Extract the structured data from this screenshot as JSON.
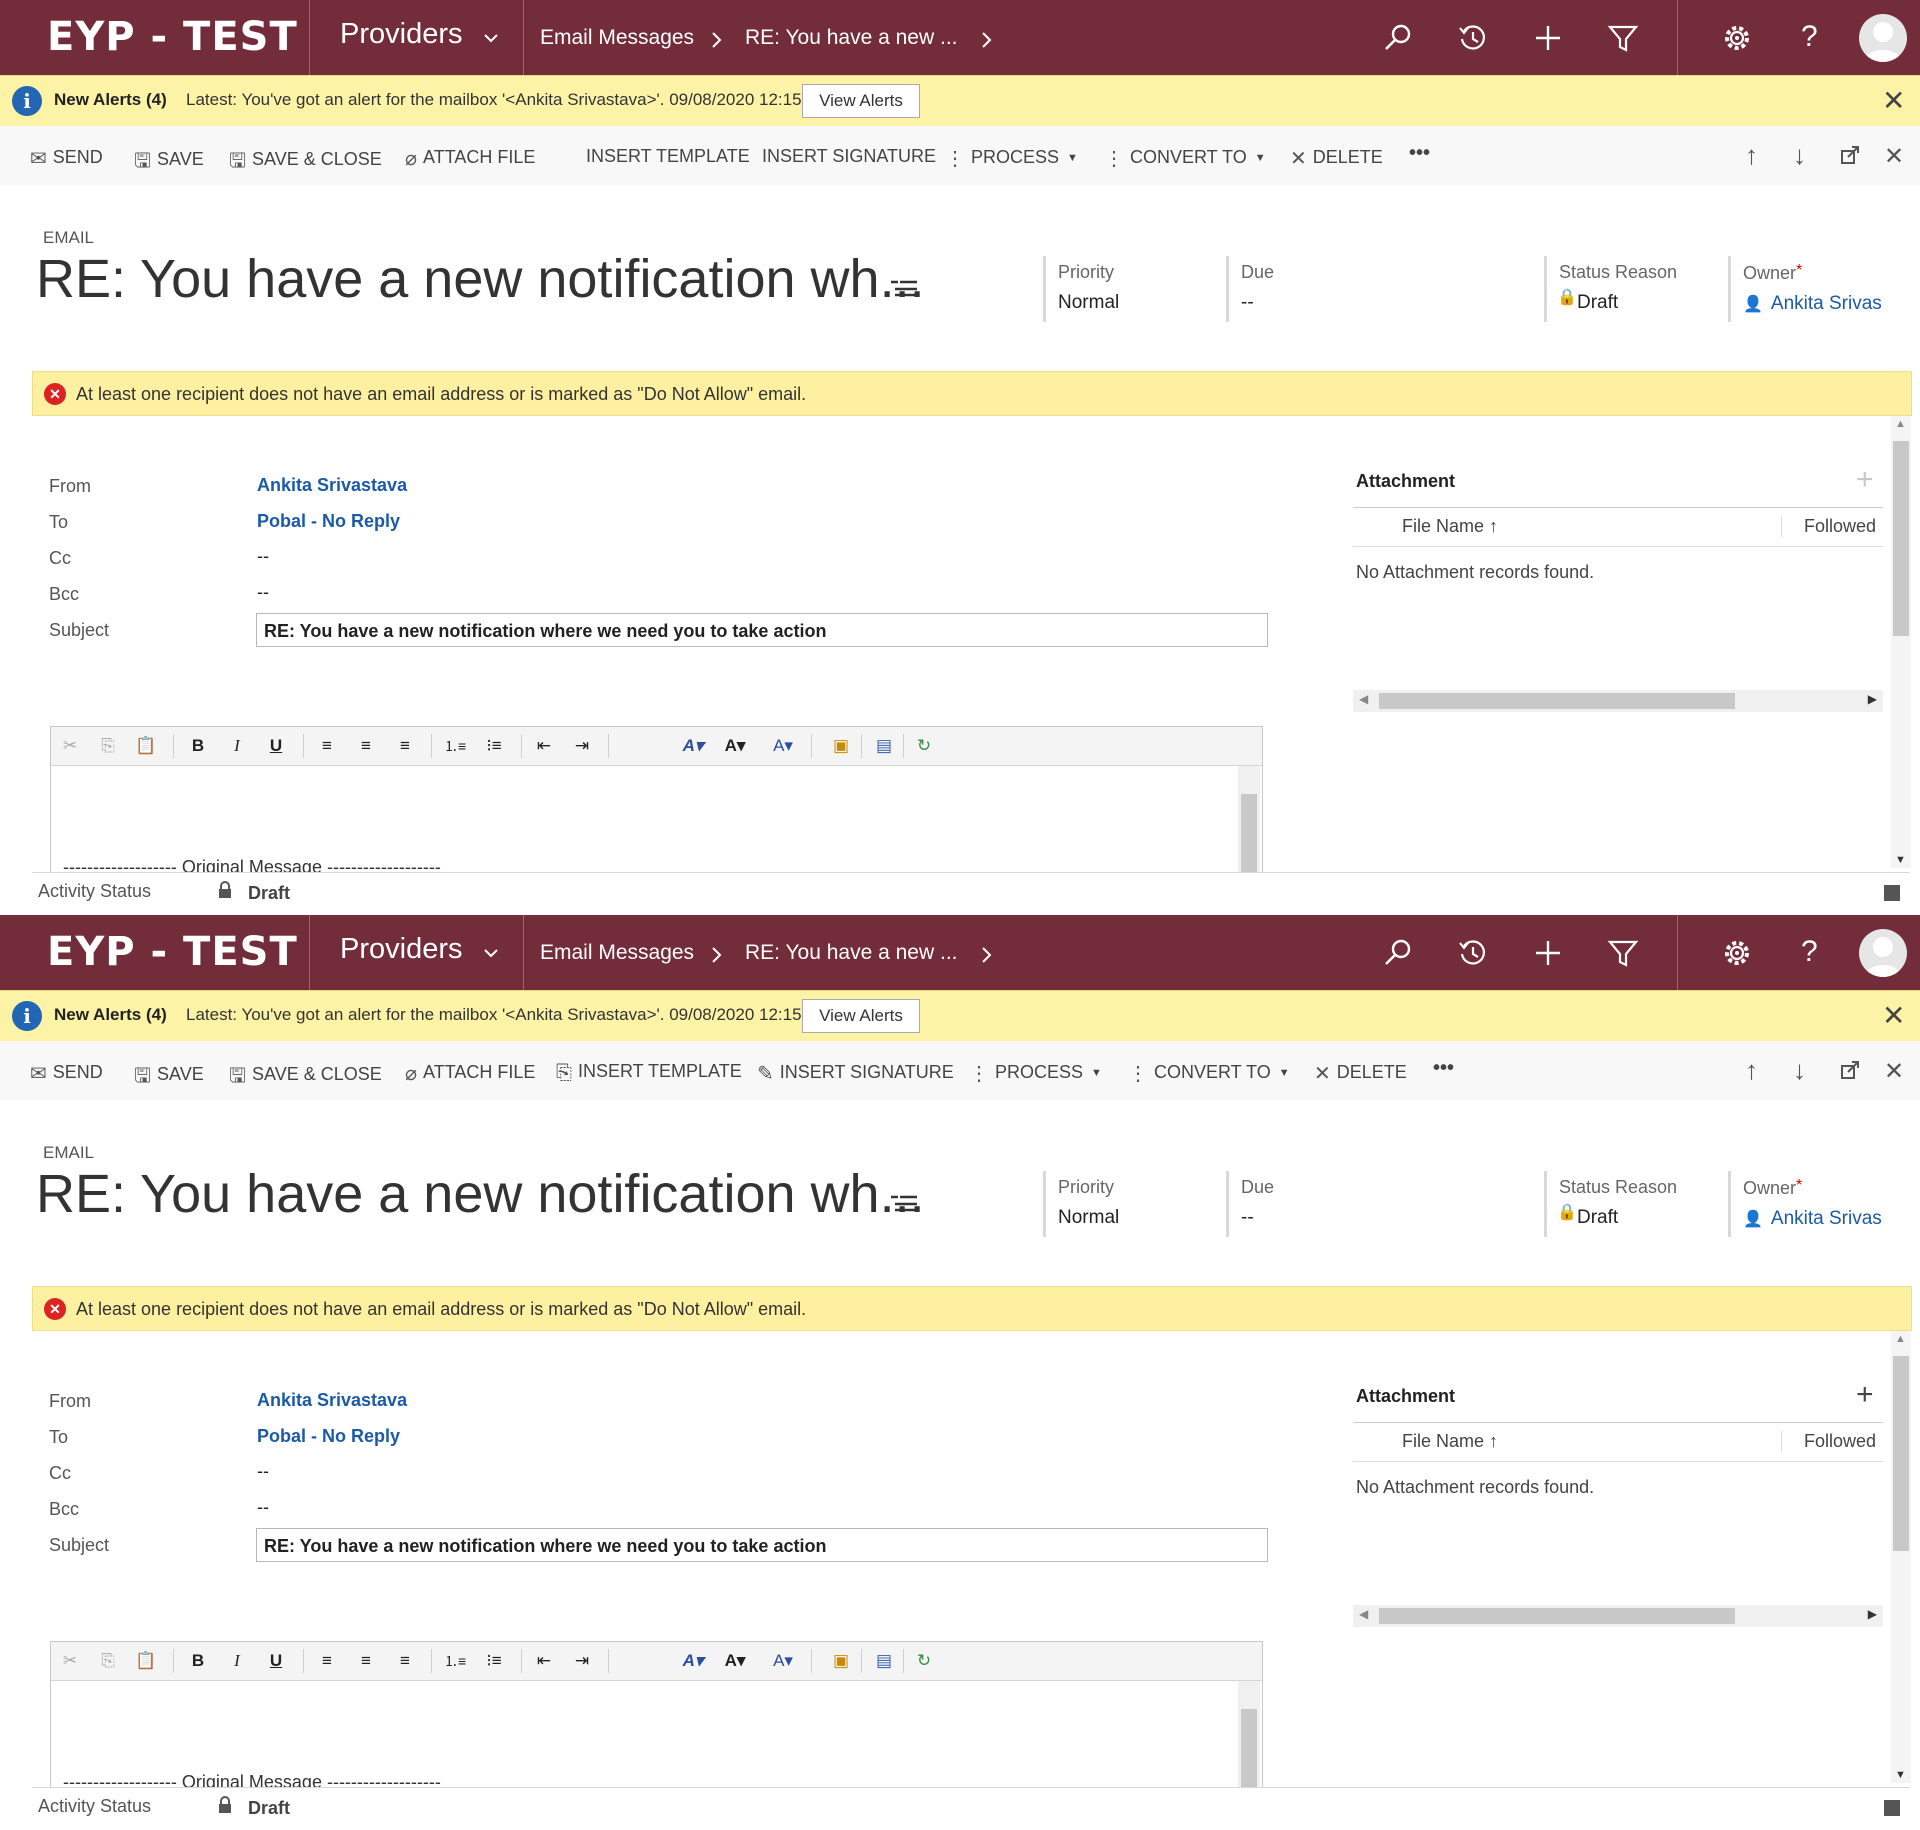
{
  "nav": {
    "brand": "EYP - TEST",
    "area": "Providers",
    "breadcrumb_1": "Email Messages",
    "breadcrumb_2": "RE: You have a new ..."
  },
  "alert": {
    "title": "New Alerts (4)",
    "message": "Latest: You've got an alert for the mailbox '<Ankita Srivastava>'. 09/08/2020 12:15",
    "button": "View Alerts"
  },
  "commands": {
    "send": "SEND",
    "save": "SAVE",
    "save_close": "SAVE & CLOSE",
    "attach_file": "ATTACH FILE",
    "insert_template": "INSERT TEMPLATE",
    "insert_signature": "INSERT SIGNATURE",
    "process": "PROCESS",
    "convert_to": "CONVERT TO",
    "delete": "DELETE",
    "more": "•••"
  },
  "header": {
    "entity": "EMAIL",
    "title": "RE: You have a new notification wh...",
    "priority_label": "Priority",
    "priority_value": "Normal",
    "due_label": "Due",
    "due_value": "--",
    "status_label": "Status Reason",
    "status_value": "Draft",
    "owner_label": "Owner",
    "owner_required": "*",
    "owner_value": "Ankita Srivas"
  },
  "warning": "At least one recipient does not have an email address or is marked as \"Do Not Allow\" email.",
  "form": {
    "from_label": "From",
    "from_value": "Ankita Srivastava",
    "to_label": "To",
    "to_value": "Pobal - No Reply",
    "cc_label": "Cc",
    "cc_value": "--",
    "bcc_label": "Bcc",
    "bcc_value": "--",
    "subject_label": "Subject",
    "subject_value": "RE: You have a new notification where we need you to take action"
  },
  "editor": {
    "original_message": "------------------- Original Message -------------------"
  },
  "attachment": {
    "title": "Attachment",
    "col_file": "File Name",
    "col_followed": "Followed",
    "empty": "No Attachment records found."
  },
  "footer": {
    "label": "Activity Status",
    "value": "Draft"
  },
  "colors": {
    "nav_bg": "#732c3a",
    "alert_bg": "#fdf3a6",
    "link": "#1b5aa7",
    "error": "#dd2222"
  }
}
